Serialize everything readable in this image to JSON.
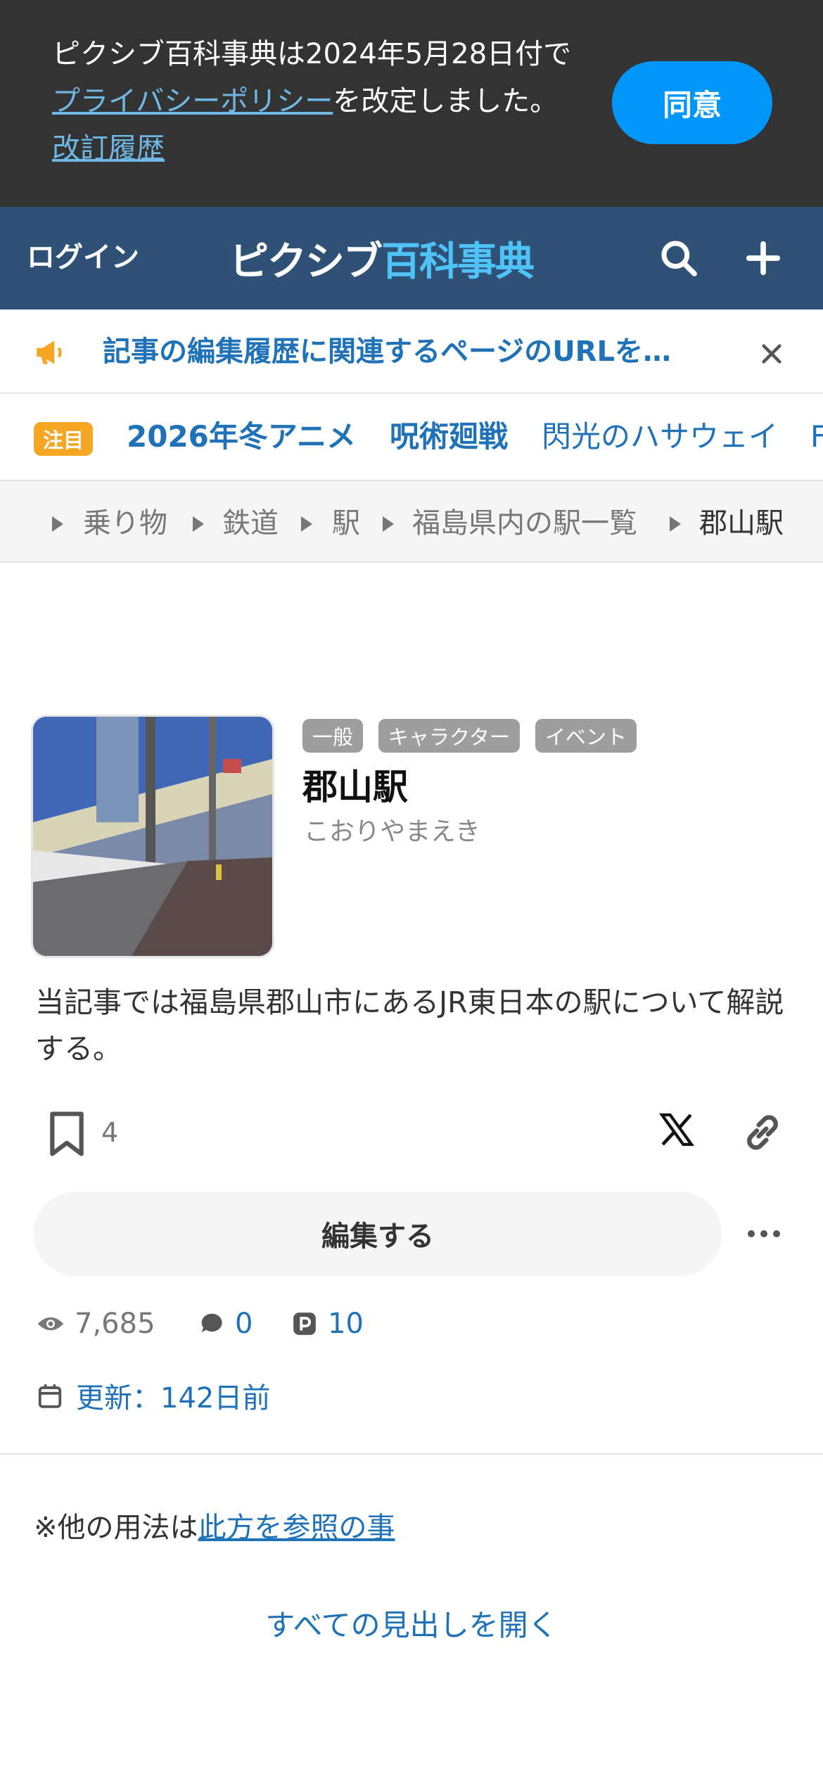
{
  "consent": {
    "text_before": "ピクシブ百科事典は2024年5月28日付で",
    "privacy_link": "プライバシーポリシー",
    "text_after": "を改定しました。",
    "history_link": "改訂履歴",
    "agree_label": "同意",
    "agree_color": "#0096fa"
  },
  "header": {
    "login_label": "ログイン",
    "logo_part1": "ピクシブ",
    "logo_part2": "百科事典",
    "bg_color": "#2f5176",
    "icons": [
      "search-icon",
      "plus-icon"
    ]
  },
  "notice": {
    "text": "記事の編集履歴に関連するページのURLを…",
    "icon": "megaphone-icon",
    "close_icon": "close-icon"
  },
  "trending": {
    "badge": "注目",
    "items": [
      "2026年冬アニメ",
      "呪術廻戦",
      "閃光のハサウェイ",
      "F"
    ]
  },
  "breadcrumb": [
    "乗り物",
    "鉄道",
    "駅",
    "福島県内の駅一覧",
    "郡山駅"
  ],
  "article": {
    "tags": [
      "一般",
      "キャラクター",
      "イベント"
    ],
    "title": "郡山駅",
    "reading": "こおりやまえき",
    "summary": "当記事では福島県郡山市にあるJR東日本の駅について解説する。",
    "bookmark_count": "4",
    "edit_label": "編集する",
    "views": "7,685",
    "comments": "0",
    "pixiv_works": "10",
    "updated": "更新：142日前",
    "note_prefix": "※他の用法は",
    "note_link": "此方を参照の事",
    "open_all": "すべての見出しを開く"
  }
}
